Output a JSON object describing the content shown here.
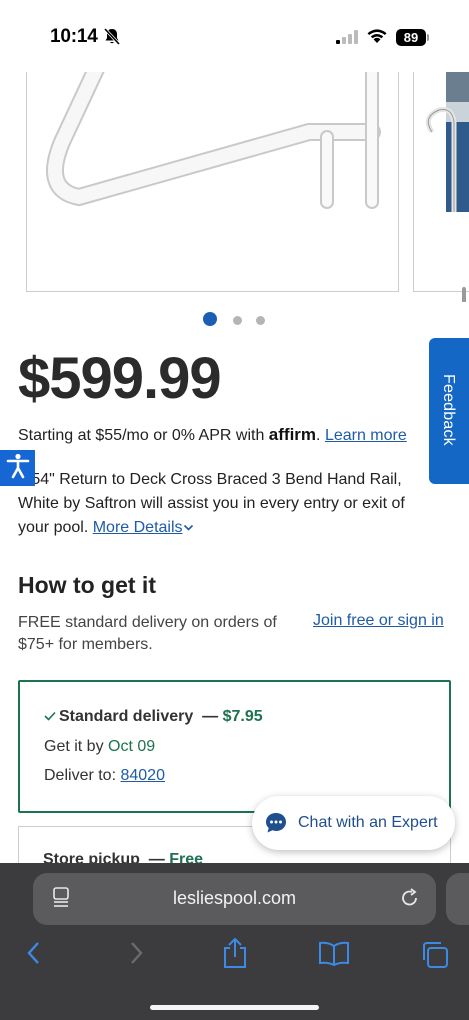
{
  "status_bar": {
    "time": "10:14",
    "battery": "89"
  },
  "gallery": {
    "images": [
      "handrail-image",
      "pool-image"
    ],
    "active_index": 0,
    "total": 3
  },
  "product": {
    "price": "$599.99",
    "financing_text": "Starting at $55/mo or 0% APR with ",
    "affirm": "affirm",
    "financing_period": ".",
    "learn_more": "Learn more",
    "description": "e 54\" Return to Deck Cross Braced 3 Bend Hand Rail, White by Saftron will assist you in every entry or exit of your pool.",
    "more_details": "More Details"
  },
  "feedback": {
    "label": "Feedback"
  },
  "how_to_get_it": {
    "heading": "How to get it",
    "note": "FREE standard delivery on orders of $75+ for members.",
    "join_link": "Join free or sign in",
    "delivery": {
      "title": "Standard delivery",
      "dash": "—",
      "price": "$7.95",
      "get_it_label": "Get it by",
      "get_it_date": "Oct 09",
      "deliver_to_label": "Deliver to:",
      "zip": "84020"
    },
    "pickup": {
      "title": "Store pickup",
      "dash": "—",
      "price": "Free"
    }
  },
  "chat": {
    "label": "Chat with an Expert"
  },
  "browser": {
    "url": "lesliespool.com"
  },
  "colors": {
    "brand_blue": "#1467c5",
    "link_blue": "#1f5ba6",
    "green": "#1e7250"
  }
}
